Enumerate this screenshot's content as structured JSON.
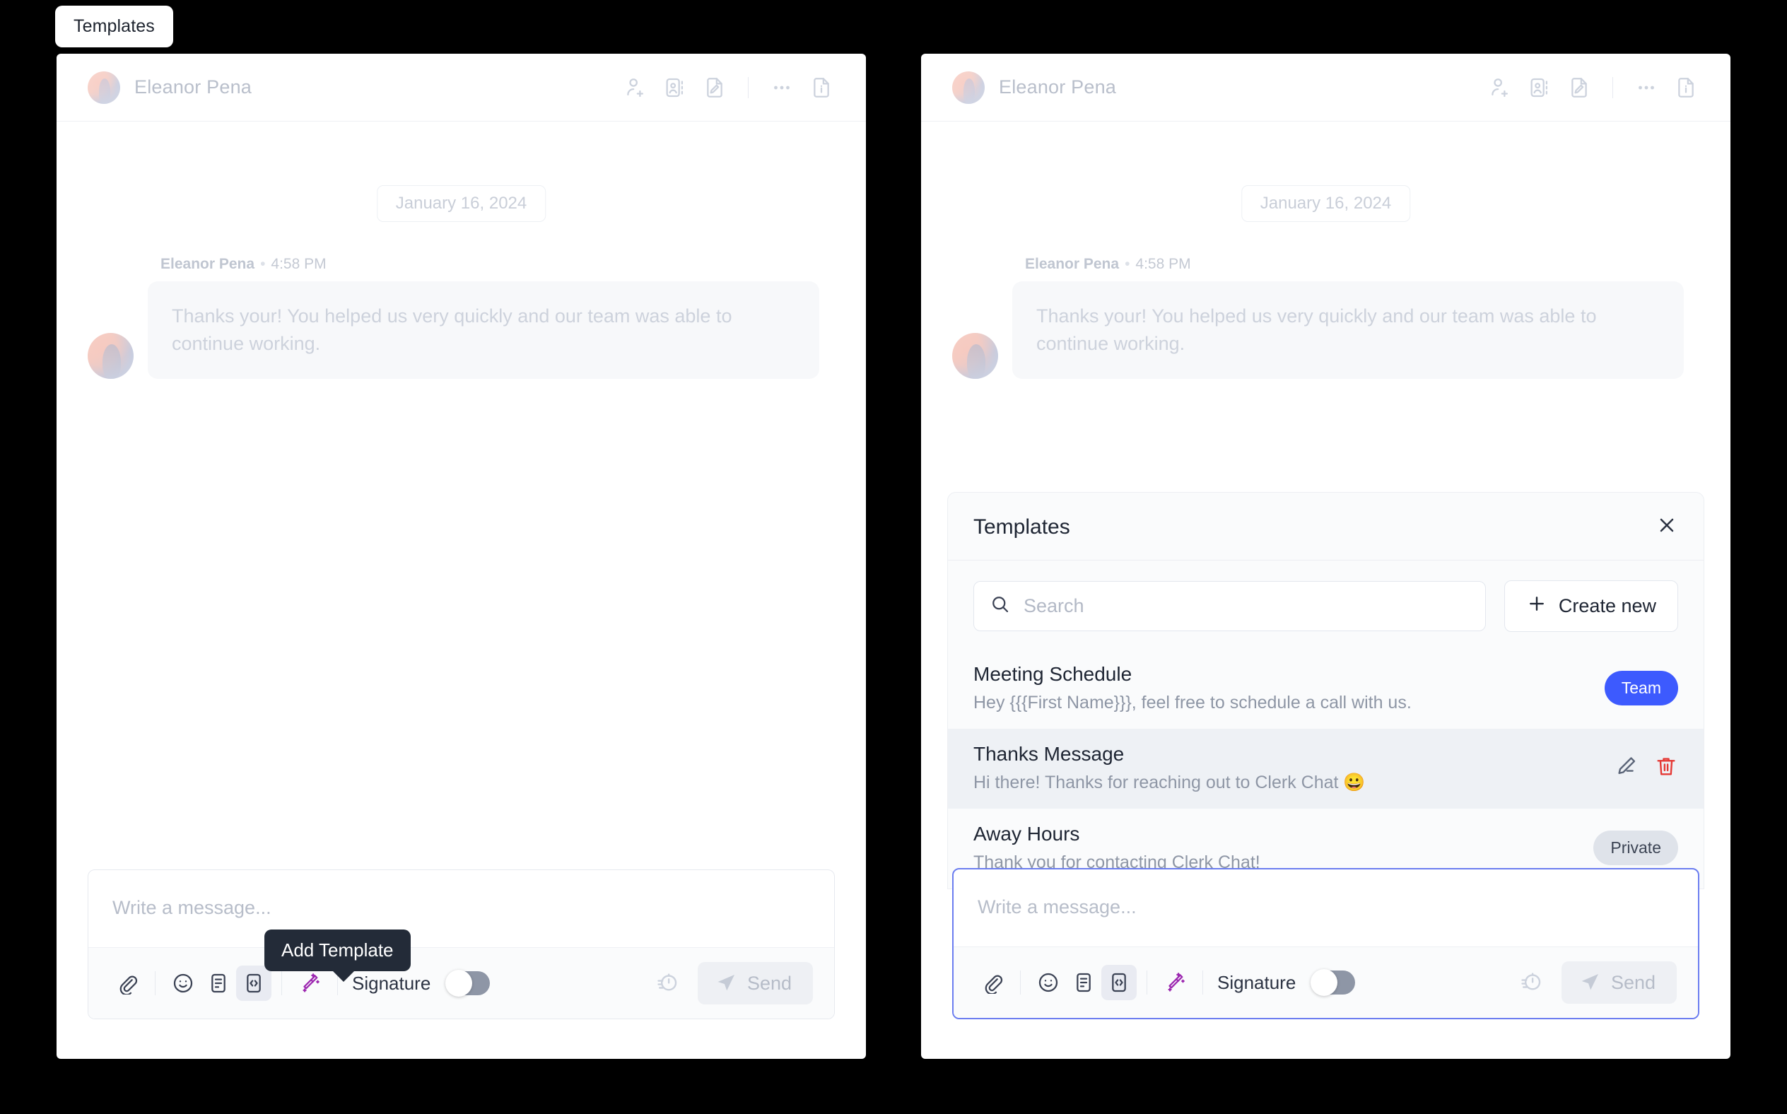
{
  "chip": {
    "label": "Templates"
  },
  "panels": {
    "left": {
      "header": {
        "contact_name": "Eleanor Pena",
        "icons": [
          "person-add-icon",
          "contact-card-icon",
          "document-edit-icon",
          "more-options-icon",
          "document-info-icon"
        ]
      },
      "conversation": {
        "date_divider": "January 16, 2024",
        "message": {
          "sender": "Eleanor Pena",
          "separator": "•",
          "time": "4:58 PM",
          "text": "Thanks your! You helped us very quickly and our team was able to continue working."
        }
      },
      "composer": {
        "placeholder": "Write a message...",
        "signature_label": "Signature",
        "signature_on": false,
        "send_label": "Send",
        "tools": [
          "attachment-icon",
          "emoji-icon",
          "note-icon",
          "template-icon",
          "ai-magic-icon"
        ],
        "right_tools": [
          "schedule-icon"
        ]
      },
      "tooltip": {
        "label": "Add Template"
      }
    },
    "right": {
      "header": {
        "contact_name": "Eleanor Pena",
        "icons": [
          "person-add-icon",
          "contact-card-icon",
          "document-edit-icon",
          "more-options-icon",
          "document-info-icon"
        ]
      },
      "conversation": {
        "date_divider": "January 16, 2024",
        "message": {
          "sender": "Eleanor Pena",
          "separator": "•",
          "time": "4:58 PM",
          "text": "Thanks your! You helped us very quickly and our team was able to continue working."
        }
      },
      "templates_popup": {
        "title": "Templates",
        "close_icon": "close-icon",
        "search_placeholder": "Search",
        "search_value": "",
        "create_label": "Create new",
        "items": [
          {
            "name": "Meeting Schedule",
            "description": "Hey {{{First Name}}}, feel free to schedule a call with us.",
            "badge": "Team",
            "badge_type": "team",
            "selected": false
          },
          {
            "name": "Thanks Message",
            "description": "Hi there! Thanks for reaching out to Clerk Chat 😀",
            "badge": "",
            "badge_type": "none",
            "selected": true,
            "actions": [
              "edit-icon",
              "delete-icon"
            ]
          },
          {
            "name": "Away Hours",
            "description": "Thank you for contacting Clerk Chat!",
            "badge": "Private",
            "badge_type": "private",
            "selected": false
          }
        ]
      },
      "composer": {
        "placeholder": "Write a message...",
        "signature_label": "Signature",
        "signature_on": false,
        "send_label": "Send",
        "tools": [
          "attachment-icon",
          "emoji-icon",
          "note-icon",
          "template-icon",
          "ai-magic-icon"
        ],
        "right_tools": [
          "schedule-icon"
        ]
      }
    }
  },
  "colors": {
    "accent_blue": "#3d5afe",
    "focus_border": "#6b7df0",
    "tooltip_bg": "#232b38",
    "magic_purple": "#9c27b0",
    "delete_red": "#e53935",
    "badge_private_bg": "#dfe3ea"
  }
}
